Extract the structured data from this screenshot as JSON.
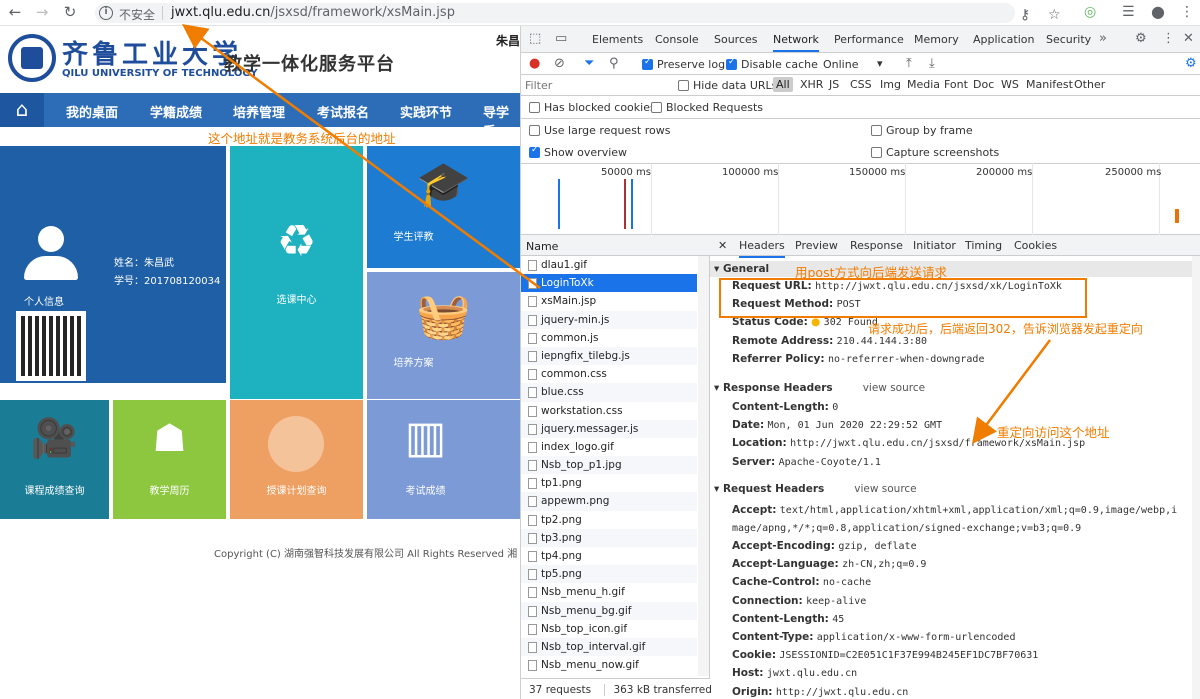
{
  "browser": {
    "not_secure": "不安全",
    "url_host": "jwxt.qlu.edu.cn",
    "url_path": "/jsxsd/framework/xsMain.jsp"
  },
  "site": {
    "logo_cn": "齐鲁工业大学",
    "logo_en": "QILU UNIVERSITY OF TECHNOLOGY",
    "platform_title": "教学一体化服务平台",
    "user_partial": "朱昌",
    "nav": [
      "我的桌面",
      "学籍成绩",
      "培养管理",
      "考试报名",
      "实践环节",
      "导学系"
    ],
    "profile": {
      "name_label": "姓名：朱昌武",
      "id_label": "学号：201708120034",
      "caption": "个人信息"
    },
    "tiles": [
      "学生评教",
      "选课中心",
      "培养方案",
      "课程成绩查询",
      "教学周历",
      "授课计划查询",
      "考试成绩"
    ],
    "copyright": "Copyright (C) 湖南强智科技发展有限公司 All Rights Reserved 湘"
  },
  "devtools": {
    "tabs": [
      "Elements",
      "Console",
      "Sources",
      "Network",
      "Performance",
      "Memory",
      "Application",
      "Security"
    ],
    "toolbar": {
      "preserve_log": "Preserve log",
      "disable_cache": "Disable cache",
      "throttle": "Online"
    },
    "filter": {
      "placeholder": "Filter",
      "hide_data_urls": "Hide data URLs",
      "all": "All",
      "types": [
        "XHR",
        "JS",
        "CSS",
        "Img",
        "Media",
        "Font",
        "Doc",
        "WS",
        "Manifest",
        "Other"
      ]
    },
    "options": {
      "blocked_cookies": "Has blocked cookies",
      "blocked_requests": "Blocked Requests",
      "large_rows": "Use large request rows",
      "group_by_frame": "Group by frame",
      "show_overview": "Show overview",
      "capture_screenshots": "Capture screenshots"
    },
    "timeline_ticks": [
      "50000 ms",
      "100000 ms",
      "150000 ms",
      "200000 ms",
      "250000 ms"
    ],
    "name_header": "Name",
    "files": [
      "dlau1.gif",
      "LoginToXk",
      "xsMain.jsp",
      "jquery-min.js",
      "common.js",
      "iepngfix_tilebg.js",
      "common.css",
      "blue.css",
      "workstation.css",
      "jquery.messager.js",
      "index_logo.gif",
      "Nsb_top_p1.jpg",
      "tp1.png",
      "appewm.png",
      "tp2.png",
      "tp3.png",
      "tp4.png",
      "tp5.png",
      "Nsb_menu_h.gif",
      "Nsb_menu_bg.gif",
      "Nsb_top_icon.gif",
      "Nsb_top_interval.gif",
      "Nsb_menu_now.gif"
    ],
    "status": {
      "requests": "37 requests",
      "transferred": "363 kB transferred"
    },
    "detail_tabs": [
      "Headers",
      "Preview",
      "Response",
      "Initiator",
      "Timing",
      "Cookies"
    ],
    "general": {
      "title": "General",
      "rows": [
        {
          "k": "Request URL:",
          "v": "http://jwxt.qlu.edu.cn/jsxsd/xk/LoginToXk"
        },
        {
          "k": "Request Method:",
          "v": "POST"
        },
        {
          "k": "Status Code:",
          "v": "302 Found"
        },
        {
          "k": "Remote Address:",
          "v": "210.44.144.3:80"
        },
        {
          "k": "Referrer Policy:",
          "v": "no-referrer-when-downgrade"
        }
      ]
    },
    "response_headers": {
      "title": "Response Headers",
      "view_source": "view source",
      "rows": [
        {
          "k": "Content-Length:",
          "v": "0"
        },
        {
          "k": "Date:",
          "v": "Mon, 01 Jun 2020 22:29:52 GMT"
        },
        {
          "k": "Location:",
          "v": "http://jwxt.qlu.edu.cn/jsxsd/framework/xsMain.jsp"
        },
        {
          "k": "Server:",
          "v": "Apache-Coyote/1.1"
        }
      ]
    },
    "request_headers": {
      "title": "Request Headers",
      "view_source": "view source",
      "accept_k": "Accept:",
      "accept_v1": "text/html,application/xhtml+xml,application/xml;q=0.9,image/webp,i",
      "accept_v2": "mage/apng,*/*;q=0.8,application/signed-exchange;v=b3;q=0.9",
      "rows": [
        {
          "k": "Accept-Encoding:",
          "v": "gzip, deflate"
        },
        {
          "k": "Accept-Language:",
          "v": "zh-CN,zh;q=0.9"
        },
        {
          "k": "Cache-Control:",
          "v": "no-cache"
        },
        {
          "k": "Connection:",
          "v": "keep-alive"
        },
        {
          "k": "Content-Length:",
          "v": "45"
        },
        {
          "k": "Content-Type:",
          "v": "application/x-www-form-urlencoded"
        },
        {
          "k": "Cookie:",
          "v": "JSESSIONID=C2E051C1F37E994B245EF1DC7BF70631"
        },
        {
          "k": "Host:",
          "v": "jwxt.qlu.edu.cn"
        },
        {
          "k": "Origin:",
          "v": "http://jwxt.qlu.edu.cn"
        }
      ]
    }
  },
  "annotations": {
    "backend_address": "这个地址就是教务系统后台的地址",
    "post_request": "用post方式向后端发送请求",
    "redirect_302": "请求成功后，后端返回302，告诉浏览器发起重定向",
    "redirect_target": "重定向访问这个地址"
  },
  "colors": {
    "accent": "#f07c00",
    "nav_blue": "#2d6db8"
  }
}
